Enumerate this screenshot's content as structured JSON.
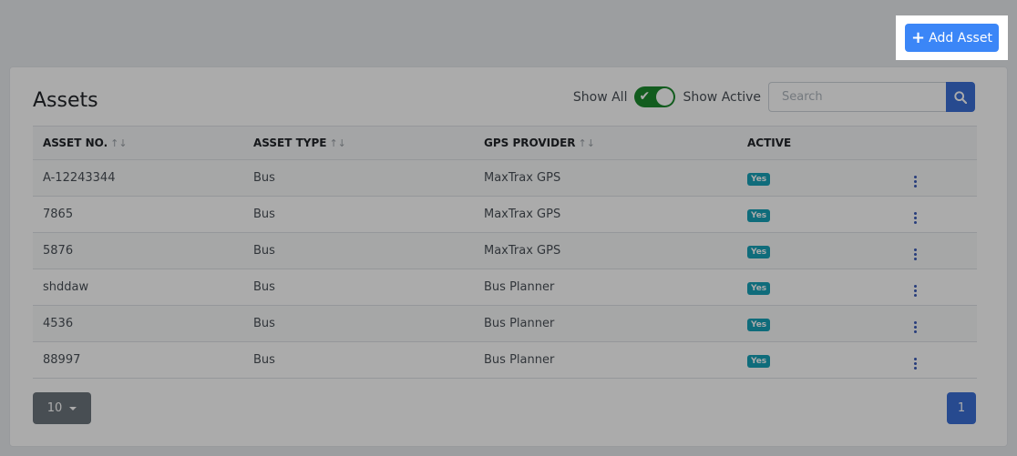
{
  "header": {
    "add_button_label": "Add Asset",
    "add_icon": "plus-icon"
  },
  "card": {
    "title": "Assets",
    "toggle_left_label": "Show All",
    "toggle_right_label": "Show Active",
    "toggle_state": "on",
    "search_placeholder": "Search",
    "search_icon": "search-icon"
  },
  "table": {
    "columns": [
      "ASSET NO.",
      "ASSET TYPE",
      "GPS PROVIDER",
      "ACTIVE"
    ],
    "sort_glyph": "↑↓",
    "rows": [
      {
        "asset_no": "A-12243344",
        "asset_type": "Bus",
        "gps_provider": "MaxTrax GPS",
        "active": "Yes"
      },
      {
        "asset_no": "7865",
        "asset_type": "Bus",
        "gps_provider": "MaxTrax GPS",
        "active": "Yes"
      },
      {
        "asset_no": "5876",
        "asset_type": "Bus",
        "gps_provider": "MaxTrax GPS",
        "active": "Yes"
      },
      {
        "asset_no": "shddaw",
        "asset_type": "Bus",
        "gps_provider": "Bus Planner",
        "active": "Yes"
      },
      {
        "asset_no": "4536",
        "asset_type": "Bus",
        "gps_provider": "Bus Planner",
        "active": "Yes"
      },
      {
        "asset_no": "88997",
        "asset_type": "Bus",
        "gps_provider": "Bus Planner",
        "active": "Yes"
      }
    ]
  },
  "footer": {
    "page_size": "10",
    "current_page": "1"
  },
  "colors": {
    "primary": "#3b86f7",
    "toggle_on": "#1b8a2e",
    "badge": "#17a2b8",
    "overlay": "rgba(0,0,0,0.33)"
  }
}
